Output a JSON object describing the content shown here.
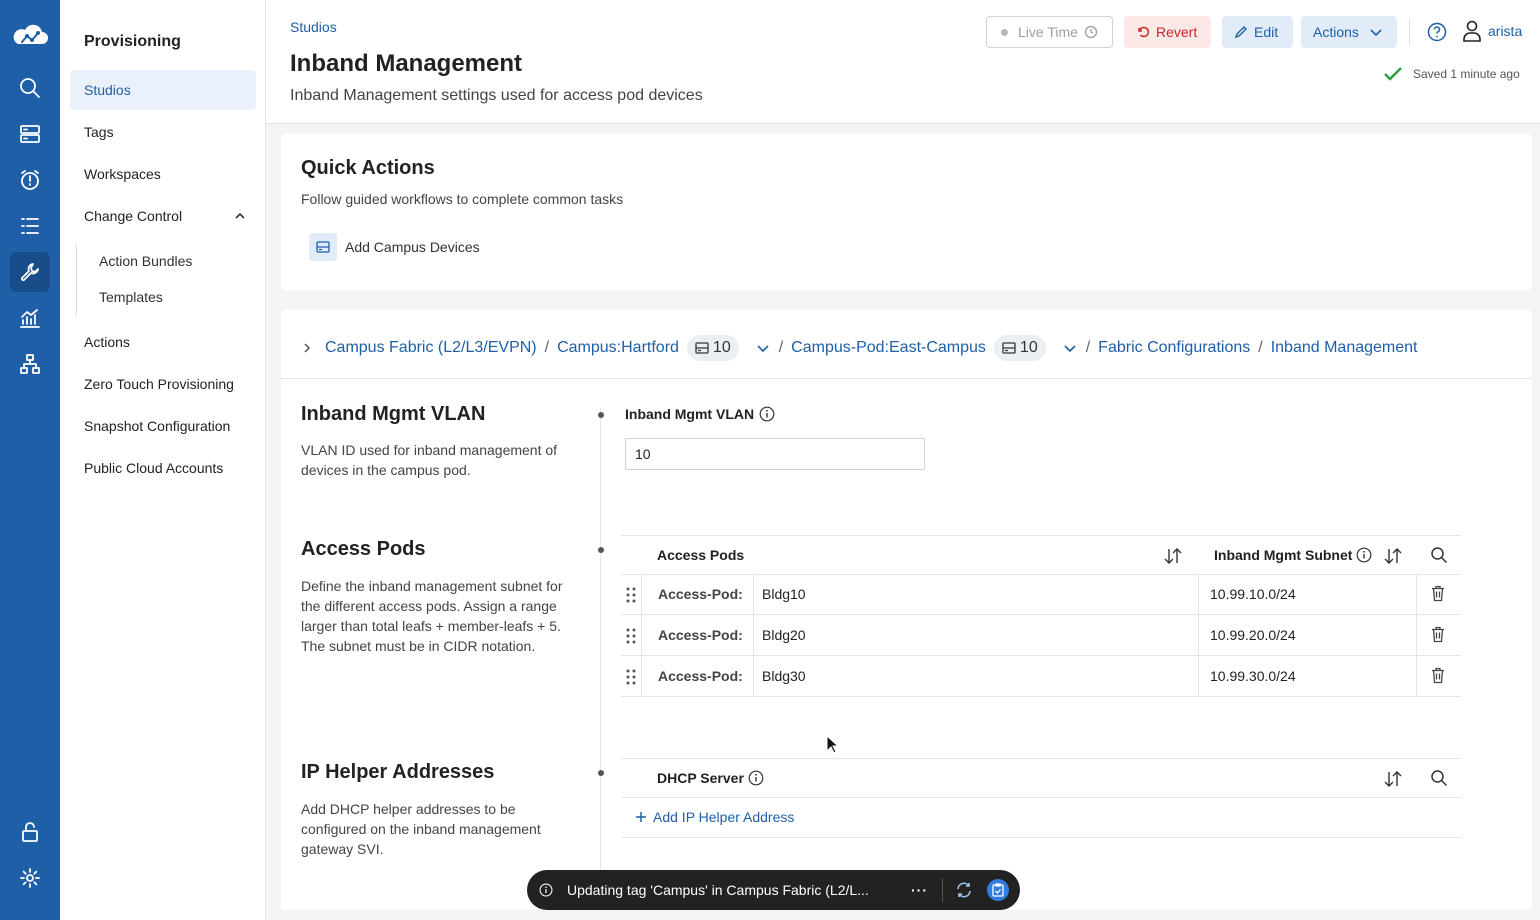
{
  "nav": {
    "title": "Provisioning",
    "items": [
      {
        "label": "Studios"
      },
      {
        "label": "Tags"
      },
      {
        "label": "Workspaces"
      },
      {
        "label": "Change Control"
      },
      {
        "label": "Actions"
      },
      {
        "label": "Zero Touch Provisioning"
      },
      {
        "label": "Snapshot Configuration"
      },
      {
        "label": "Public Cloud Accounts"
      }
    ],
    "subitems": [
      {
        "label": "Action Bundles"
      },
      {
        "label": "Templates"
      }
    ]
  },
  "header": {
    "breadcrumb": "Studios",
    "title": "Inband Management",
    "subtitle": "Inband Management settings used for access pod devices",
    "live_time": "Live Time",
    "revert": "Revert",
    "edit": "Edit",
    "actions": "Actions",
    "user": "arista",
    "saved": "Saved 1 minute ago"
  },
  "quick_actions": {
    "title": "Quick Actions",
    "subtitle": "Follow guided workflows to complete common tasks",
    "item": "Add Campus Devices"
  },
  "breadcrumb": {
    "fabric": "Campus Fabric (L2/L3/EVPN)",
    "campus": "Campus:Hartford",
    "campus_count": "10",
    "pod": "Campus-Pod:East-Campus",
    "pod_count": "10",
    "fabric_config": "Fabric Configurations",
    "current": "Inband Management"
  },
  "vlan": {
    "title": "Inband Mgmt VLAN",
    "description": "VLAN ID used for inband management of devices in the campus pod.",
    "field_label": "Inband Mgmt VLAN",
    "value": "10"
  },
  "access_pods": {
    "title": "Access Pods",
    "description": "Define the inband management subnet for the different access pods. Assign a range larger than total leafs + member-leafs + 5. The subnet must be in CIDR notation.",
    "col_pods": "Access Pods",
    "col_subnet": "Inband Mgmt Subnet",
    "rows": [
      {
        "key": "Access-Pod:",
        "name": "Bldg10",
        "subnet": "10.99.10.0/24"
      },
      {
        "key": "Access-Pod:",
        "name": "Bldg20",
        "subnet": "10.99.20.0/24"
      },
      {
        "key": "Access-Pod:",
        "name": "Bldg30",
        "subnet": "10.99.30.0/24"
      }
    ]
  },
  "ip_helper": {
    "title": "IP Helper Addresses",
    "description": "Add DHCP helper addresses to be configured on the inband management gateway SVI.",
    "col": "DHCP Server",
    "add": "Add IP Helper Address"
  },
  "toast": {
    "message": "Updating tag 'Campus' in Campus Fabric (L2/L...",
    "more": "···"
  },
  "colors": {
    "brand": "#1f5fa8",
    "revert": "#c62828",
    "success": "#2e9e44"
  }
}
